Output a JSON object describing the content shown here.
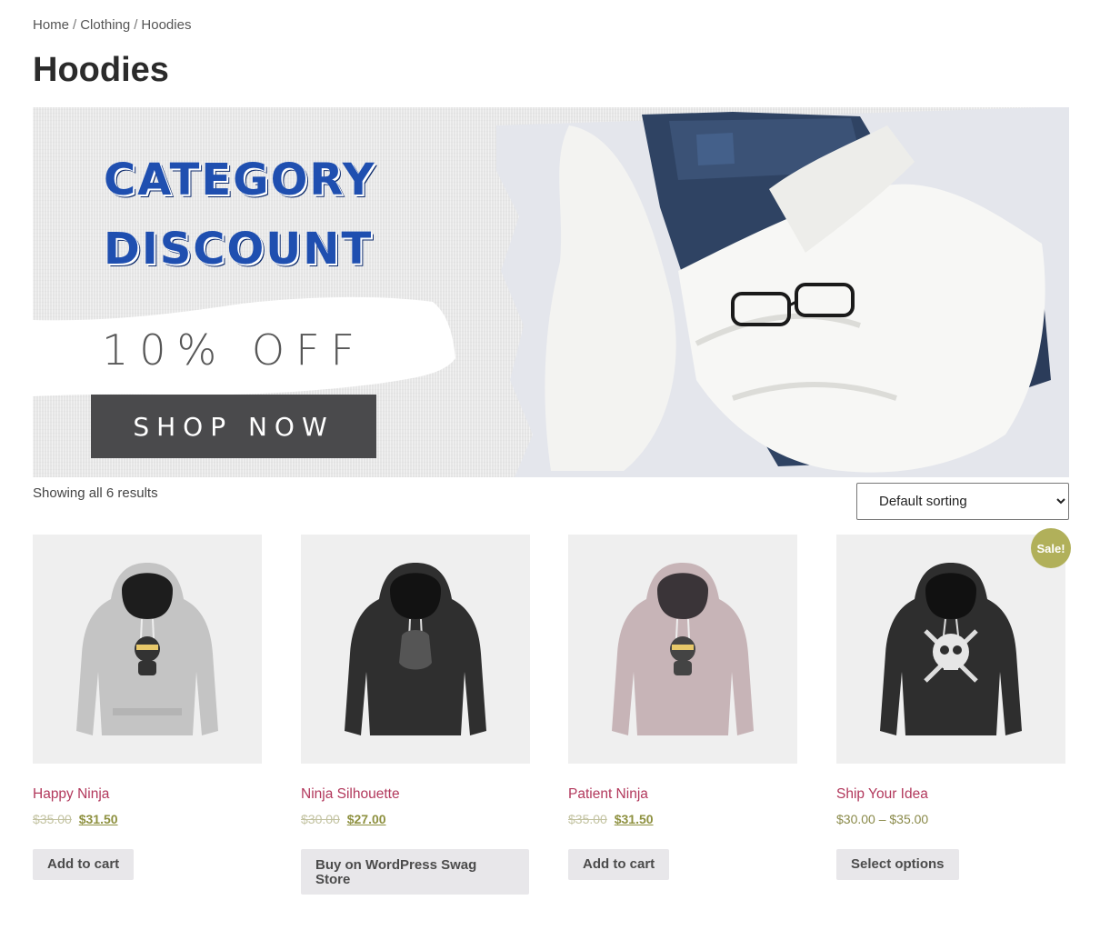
{
  "breadcrumb": {
    "items": [
      "Home",
      "Clothing",
      "Hoodies"
    ],
    "separator": "/"
  },
  "page": {
    "title": "Hoodies"
  },
  "banner": {
    "line1": "CATEGORY",
    "line2": "DISCOUNT",
    "offer": "10% OFF",
    "cta": "SHOP NOW"
  },
  "toolbar": {
    "result_count": "Showing all 6 results",
    "sort_selected": "Default sorting"
  },
  "products": [
    {
      "name": "Happy Ninja",
      "price_old": "$35.00",
      "price_new": "$31.50",
      "button": "Add to cart",
      "image_icon": "hoodie-icon",
      "hoodie_color": "#c4c4c4"
    },
    {
      "name": "Ninja Silhouette",
      "price_old": "$30.00",
      "price_new": "$27.00",
      "button": "Buy on WordPress Swag Store",
      "image_icon": "hoodie-icon",
      "hoodie_color": "#2f2f2f"
    },
    {
      "name": "Patient Ninja",
      "price_old": "$35.00",
      "price_new": "$31.50",
      "button": "Add to cart",
      "image_icon": "hoodie-icon",
      "hoodie_color": "#c7b4b7"
    },
    {
      "name": "Ship Your Idea",
      "price_range": "$30.00 – $35.00",
      "button": "Select options",
      "badge": "Sale!",
      "image_icon": "hoodie-icon",
      "hoodie_color": "#2e2e2e"
    }
  ],
  "colors": {
    "product_link": "#b2385c",
    "price": "#8e9140",
    "sale_badge": "#b1b05a",
    "banner_title": "#1f4fb0",
    "shop_now_bg": "#4a4a4c"
  }
}
